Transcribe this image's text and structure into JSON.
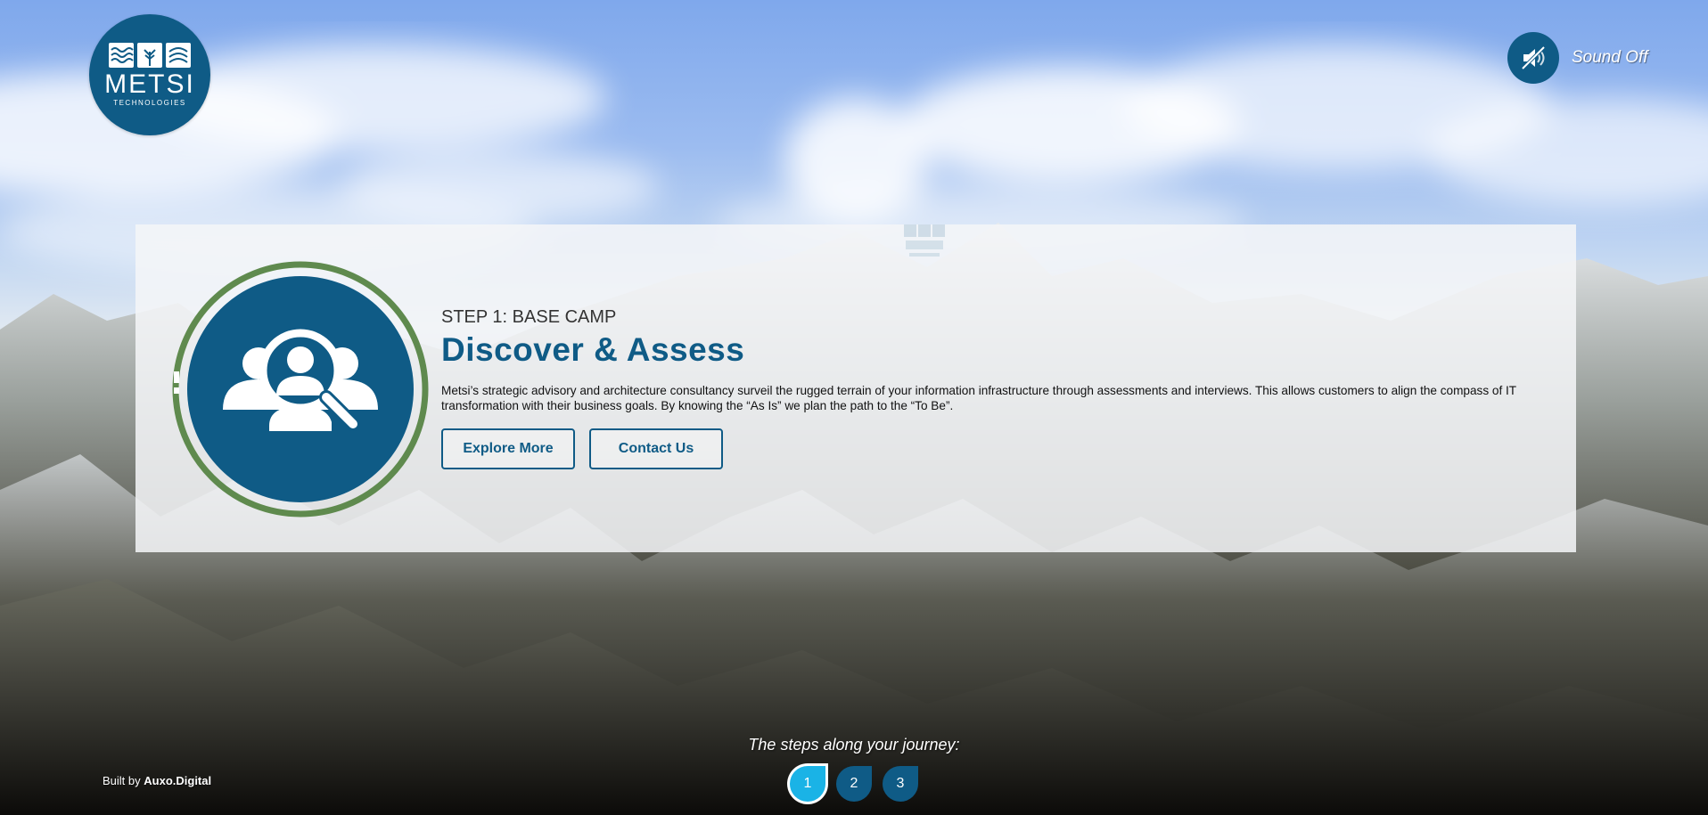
{
  "header": {
    "logo": {
      "word": "METSI",
      "sub": "TECHNOLOGIES"
    },
    "sound": {
      "label": "Sound Off",
      "icon": "speaker-muted-icon"
    }
  },
  "panel": {
    "kicker": "STEP 1: BASE CAMP",
    "title": "Discover & Assess",
    "description": "Metsi’s strategic advisory and architecture consultancy surveil the rugged terrain of your information infrastructure through assessments and interviews. This allows customers to align the compass of IT transformation with their business goals. By knowing the “As Is” we plan the path to the “To Be”.",
    "icon": "people-search-icon",
    "buttons": {
      "explore": "Explore More",
      "contact": "Contact Us"
    }
  },
  "journey": {
    "label": "The steps along your journey:",
    "steps": [
      "1",
      "2",
      "3"
    ],
    "active_step": "1"
  },
  "footer": {
    "built_prefix": "Built by",
    "built_brand": "Auxo.Digital"
  },
  "colors": {
    "brand_blue": "#0f5b86",
    "active_step": "#1ab3e6",
    "ring_green": "#5f8a4e"
  }
}
